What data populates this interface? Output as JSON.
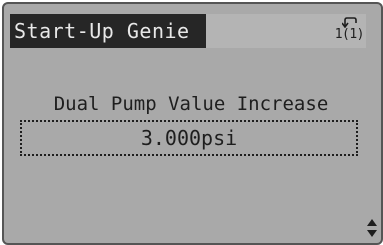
{
  "header": {
    "title": "Start-Up Genie",
    "menu_indicator": "1(1)",
    "menu_icon": "return-arrow-icon"
  },
  "parameter": {
    "label": "Dual Pump Value Increase",
    "value": "3.000psi"
  },
  "footer": {
    "scroll_icon": "up-down-arrows-icon"
  },
  "colors": {
    "screen_bg": "#a9a9a9",
    "title_bg": "#262626",
    "title_text": "#e8e8e8",
    "text": "#1e1e1e"
  }
}
